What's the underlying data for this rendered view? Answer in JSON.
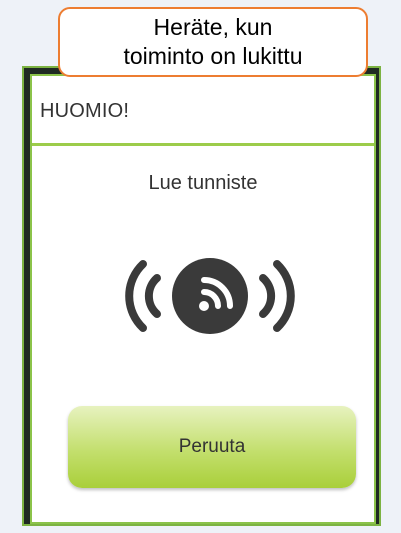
{
  "callout": {
    "line1": "Heräte, kun",
    "line2": "toiminto on lukittu"
  },
  "dialog": {
    "title": "HUOMIO!",
    "prompt": "Lue tunniste",
    "cancel_label": "Peruuta"
  },
  "icon": {
    "name": "nfc-reader-icon"
  },
  "colors": {
    "accent_green": "#8bc34a",
    "callout_border": "#ed7d31",
    "icon_dark": "#3a3a3a"
  }
}
